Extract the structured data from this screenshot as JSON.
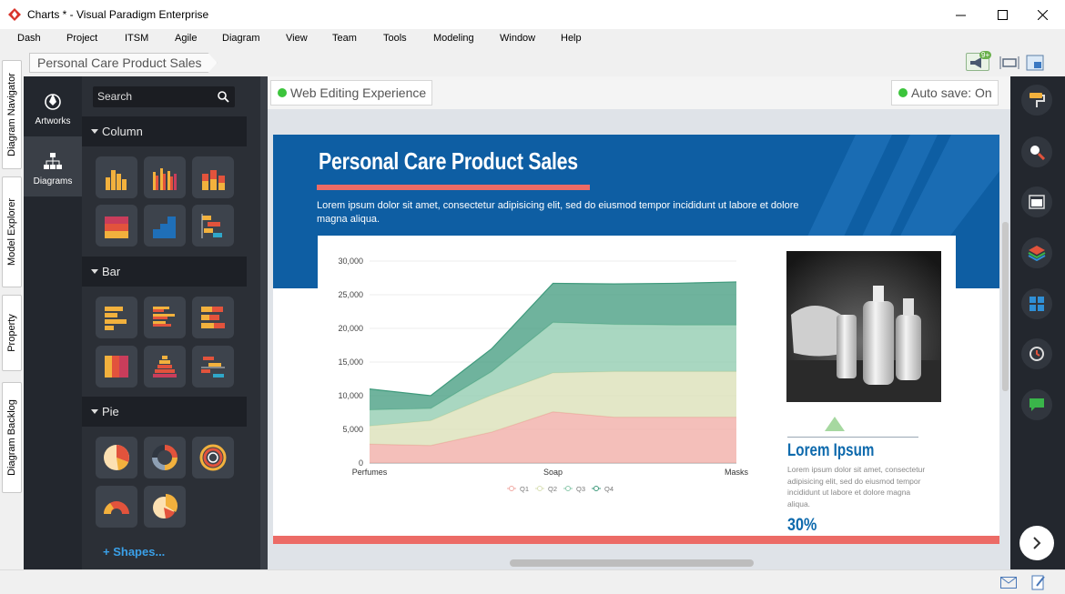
{
  "window": {
    "title": "Charts * - Visual Paradigm Enterprise"
  },
  "menu": [
    "Dash",
    "Project",
    "ITSM",
    "Agile",
    "Diagram",
    "View",
    "Team",
    "Tools",
    "Modeling",
    "Window",
    "Help"
  ],
  "breadcrumb": "Personal Care Product Sales",
  "notification_badge": "9+",
  "left_tabs": [
    "Diagram Navigator",
    "Model Explorer",
    "Property",
    "Diagram Backlog"
  ],
  "side_panel": {
    "tabs": [
      "Artworks",
      "Diagrams"
    ],
    "search_placeholder": "Search",
    "groups": [
      "Column",
      "Bar",
      "Pie"
    ],
    "shapes_link": "Shapes..."
  },
  "canvas": {
    "web_editing": "Web Editing Experience",
    "autosave": "Auto save: On"
  },
  "infographic": {
    "title": "Personal Care Product Sales",
    "lead": "Lorem ipsum dolor sit amet, consectetur adipisicing elit, sed do eiusmod tempor incididunt ut labore et dolore magna aliqua.",
    "percent": "30%",
    "heading": "Lorem Ipsum",
    "body": "Lorem ipsum dolor sit amet, consectetur adipisicing elit, sed do eiusmod tempor incididunt ut labore et dolore magna aliqua.",
    "colors": {
      "banner": "#0e5ea3",
      "accent": "#ec6b66",
      "heading": "#0e6aad"
    }
  },
  "chart_data": {
    "type": "area",
    "stacked": true,
    "categories": [
      "Perfumes",
      "Soap",
      "Masks"
    ],
    "x": [
      0,
      1,
      2,
      3,
      4,
      5,
      6
    ],
    "x_tick_labels": [
      [
        "Perfumes",
        0
      ],
      [
        "Soap",
        3
      ],
      [
        "Masks",
        6
      ]
    ],
    "ylim": [
      0,
      30000
    ],
    "yticks": [
      "0",
      "5,000",
      "10,000",
      "15,000",
      "20,000",
      "25,000",
      "30,000"
    ],
    "series": [
      {
        "name": "Q1",
        "color": "#f0a9a3",
        "values": [
          2800,
          2600,
          4600,
          7600,
          6800,
          6800,
          6800
        ]
      },
      {
        "name": "Q2",
        "color": "#d9dfb4",
        "values": [
          2700,
          3700,
          5500,
          5800,
          6800,
          6800,
          6800
        ]
      },
      {
        "name": "Q3",
        "color": "#8cc9ac",
        "values": [
          2400,
          1800,
          3500,
          7500,
          7000,
          6900,
          6900
        ]
      },
      {
        "name": "Q4",
        "color": "#3f9a7c",
        "values": [
          3100,
          1900,
          3400,
          5800,
          6000,
          6200,
          6400
        ]
      }
    ],
    "legend_position": "bottom",
    "grid": true
  }
}
